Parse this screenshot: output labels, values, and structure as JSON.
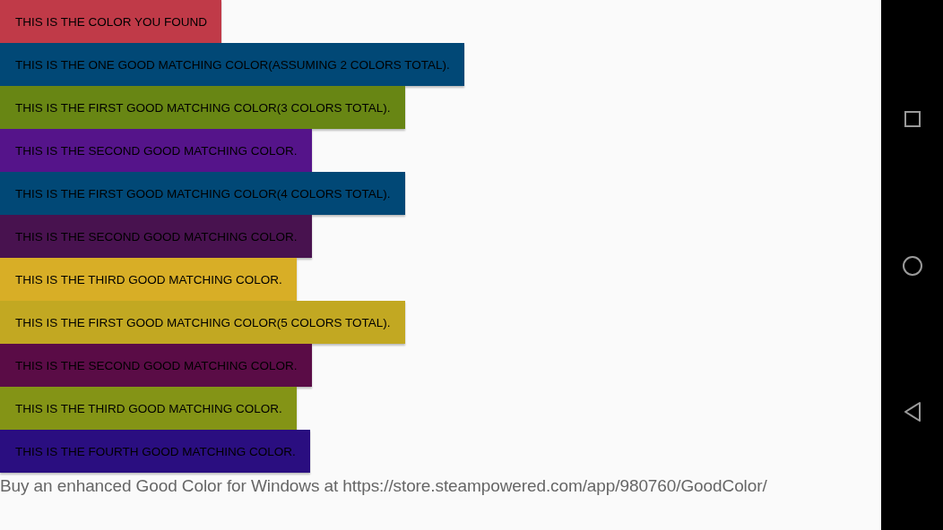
{
  "color_buttons": [
    {
      "label": "THIS IS THE COLOR YOU FOUND",
      "color": "#c03a48"
    },
    {
      "label": "THIS IS THE ONE GOOD MATCHING COLOR(ASSUMING 2 COLORS TOTAL).",
      "color": "#014876"
    },
    {
      "label": "THIS IS THE FIRST GOOD MATCHING COLOR(3 COLORS TOTAL).",
      "color": "#688614"
    },
    {
      "label": "THIS IS THE SECOND GOOD MATCHING COLOR.",
      "color": "#55148a"
    },
    {
      "label": "THIS IS THE FIRST GOOD MATCHING COLOR(4 COLORS TOTAL).",
      "color": "#014876"
    },
    {
      "label": "THIS IS THE SECOND GOOD MATCHING COLOR.",
      "color": "#48124f"
    },
    {
      "label": "THIS IS THE THIRD GOOD MATCHING COLOR.",
      "color": "#d8ae26"
    },
    {
      "label": "THIS IS THE FIRST GOOD MATCHING COLOR(5 COLORS TOTAL).",
      "color": "#c2a822"
    },
    {
      "label": "THIS IS THE SECOND GOOD MATCHING COLOR.",
      "color": "#5a0c46"
    },
    {
      "label": "THIS IS THE THIRD GOOD MATCHING COLOR.",
      "color": "#849416"
    },
    {
      "label": "THIS IS THE FOURTH GOOD MATCHING COLOR.",
      "color": "#2a0e80"
    }
  ],
  "footer_text": "Buy an enhanced Good Color for Windows at https://store.steampowered.com/app/980760/GoodColor/"
}
